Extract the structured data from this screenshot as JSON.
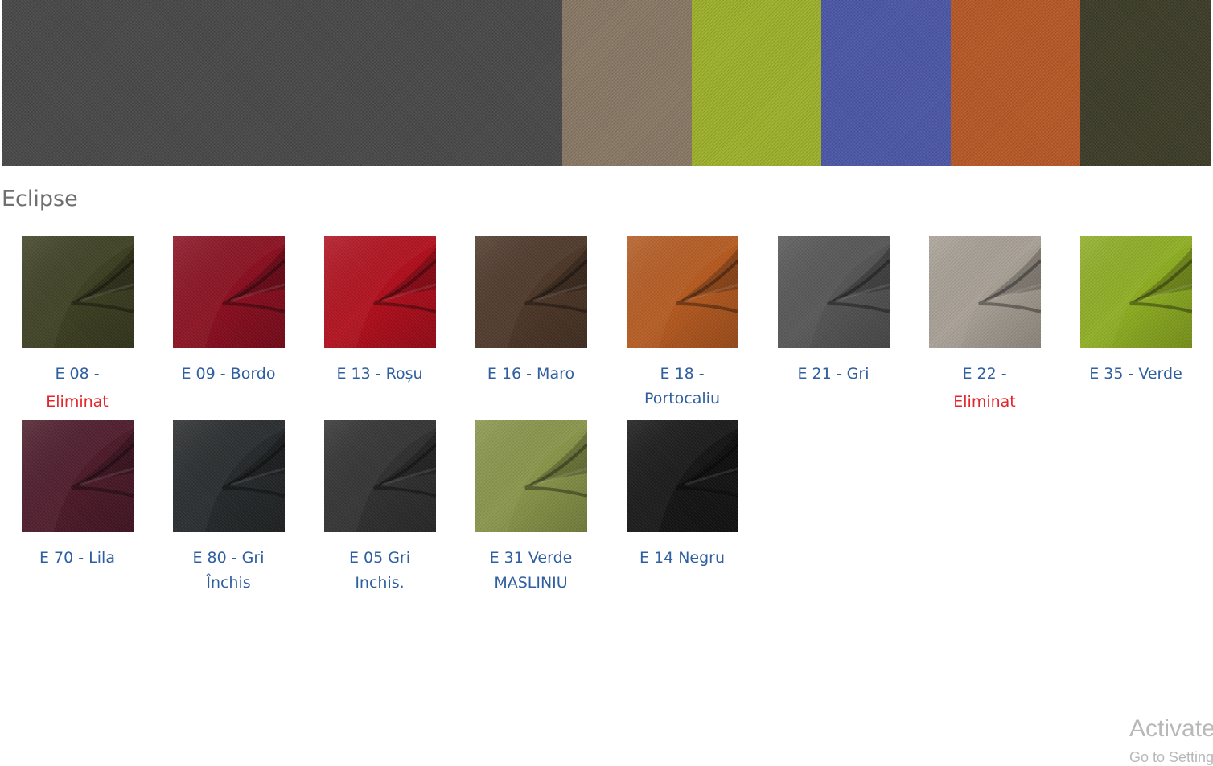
{
  "banner": {
    "strips": [
      {
        "name": "charcoal",
        "color": "#4a4a4a"
      },
      {
        "name": "beige",
        "color": "#8a7966"
      },
      {
        "name": "lime",
        "color": "#9fb22d"
      },
      {
        "name": "blue",
        "color": "#4d59a8"
      },
      {
        "name": "orange",
        "color": "#b85a28"
      },
      {
        "name": "olive-dark",
        "color": "#3e3e2a"
      }
    ]
  },
  "section": {
    "title": "Eclipse"
  },
  "colors": {
    "label": "#2f5fa0",
    "eliminat": "#e3242b"
  },
  "swatches": [
    {
      "line1": "E 08 -",
      "line2": "Eliminat",
      "eliminated": true,
      "color": "#3d3f22"
    },
    {
      "line1": "E 09 - Bordo",
      "line2": "",
      "eliminated": false,
      "color": "#8a0e1f"
    },
    {
      "line1": "E 13 - Roșu",
      "line2": "",
      "eliminated": false,
      "color": "#b10e1c"
    },
    {
      "line1": "E 16 - Maro",
      "line2": "",
      "eliminated": false,
      "color": "#4d3728"
    },
    {
      "line1": "E 18 -",
      "line2": "Portocaliu",
      "eliminated": false,
      "color": "#b65a20"
    },
    {
      "line1": "E 21 - Gri",
      "line2": "",
      "eliminated": false,
      "color": "#555555"
    },
    {
      "line1": "E 22 -",
      "line2": "Eliminat",
      "eliminated": true,
      "color": "#a8a095"
    },
    {
      "line1": "E 35 - Verde",
      "line2": "",
      "eliminated": false,
      "color": "#8fae22"
    },
    {
      "line1": "E 70 - Lila",
      "line2": "",
      "eliminated": false,
      "color": "#4d1a2a"
    },
    {
      "line1": "E 80 - Gri",
      "line2": "Închis",
      "eliminated": false,
      "color": "#26292b"
    },
    {
      "line1": "E 05 Gri",
      "line2": "Inchis.",
      "eliminated": false,
      "color": "#303030"
    },
    {
      "line1": "E 31 Verde",
      "line2": "MASLINIU",
      "eliminated": false,
      "color": "#899549"
    },
    {
      "line1": "E 14 Negru",
      "line2": "",
      "eliminated": false,
      "color": "#151515"
    }
  ],
  "watermark": {
    "line1": "Activate",
    "line2": "Go to Settings"
  }
}
